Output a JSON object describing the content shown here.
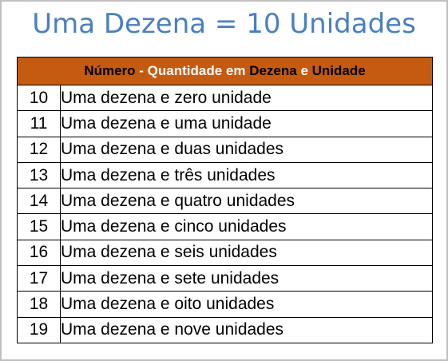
{
  "title": "Uma Dezena = 10 Unidades",
  "header": {
    "parts": [
      "Número",
      " - ",
      "Quantidade em ",
      "Dezena",
      " e ",
      "Unidade"
    ]
  },
  "rows": [
    {
      "number": "10",
      "text": "Uma dezena e zero unidade"
    },
    {
      "number": "11",
      "text": "Uma dezena e uma unidade"
    },
    {
      "number": "12",
      "text": "Uma dezena e duas unidades"
    },
    {
      "number": "13",
      "text": "Uma dezena e três unidades"
    },
    {
      "number": "14",
      "text": "Uma dezena e quatro unidades"
    },
    {
      "number": "15",
      "text": "Uma dezena e cinco unidades"
    },
    {
      "number": "16",
      "text": "Uma dezena e seis unidades"
    },
    {
      "number": "17",
      "text": "Uma dezena e sete unidades"
    },
    {
      "number": "18",
      "text": "Uma dezena e oito unidades"
    },
    {
      "number": "19",
      "text": "Uma dezena e nove unidades"
    }
  ],
  "colors": {
    "title": "#4a7fc1",
    "header_bg": "#c55a11",
    "header_dark_text": "#000000",
    "header_light_text": "#ffffff",
    "border": "#000000"
  }
}
